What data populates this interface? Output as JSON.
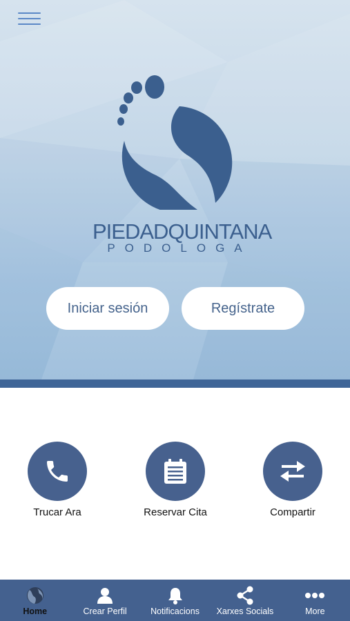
{
  "header": {
    "menu_icon": "hamburger-menu-icon"
  },
  "brand": {
    "logo_icon": "footprint-logo-icon",
    "name": "PIEDADQUINTANA",
    "subtitle": "PODOLOGA"
  },
  "auth": {
    "login_label": "Iniciar sesión",
    "register_label": "Regístrate"
  },
  "actions": [
    {
      "label": "Trucar Ara",
      "icon": "phone-icon"
    },
    {
      "label": "Reservar Cita",
      "icon": "calendar-icon"
    },
    {
      "label": "Compartir",
      "icon": "share-arrows-icon"
    }
  ],
  "tabbar": {
    "tabs": [
      {
        "label": "Home",
        "icon": "home-globe-icon",
        "active": true
      },
      {
        "label": "Crear Perfil",
        "icon": "user-icon",
        "active": false
      },
      {
        "label": "Notificacions",
        "icon": "bell-icon",
        "active": false
      },
      {
        "label": "Xarxes Socials",
        "icon": "share-nodes-icon",
        "active": false
      },
      {
        "label": "More",
        "icon": "more-dots-icon",
        "active": false
      }
    ]
  },
  "colors": {
    "primary": "#47618e",
    "tabbar": "#44618f",
    "stripe": "#3f6597",
    "logo": "#3b5f8e",
    "active_tab_text": "#111111"
  }
}
